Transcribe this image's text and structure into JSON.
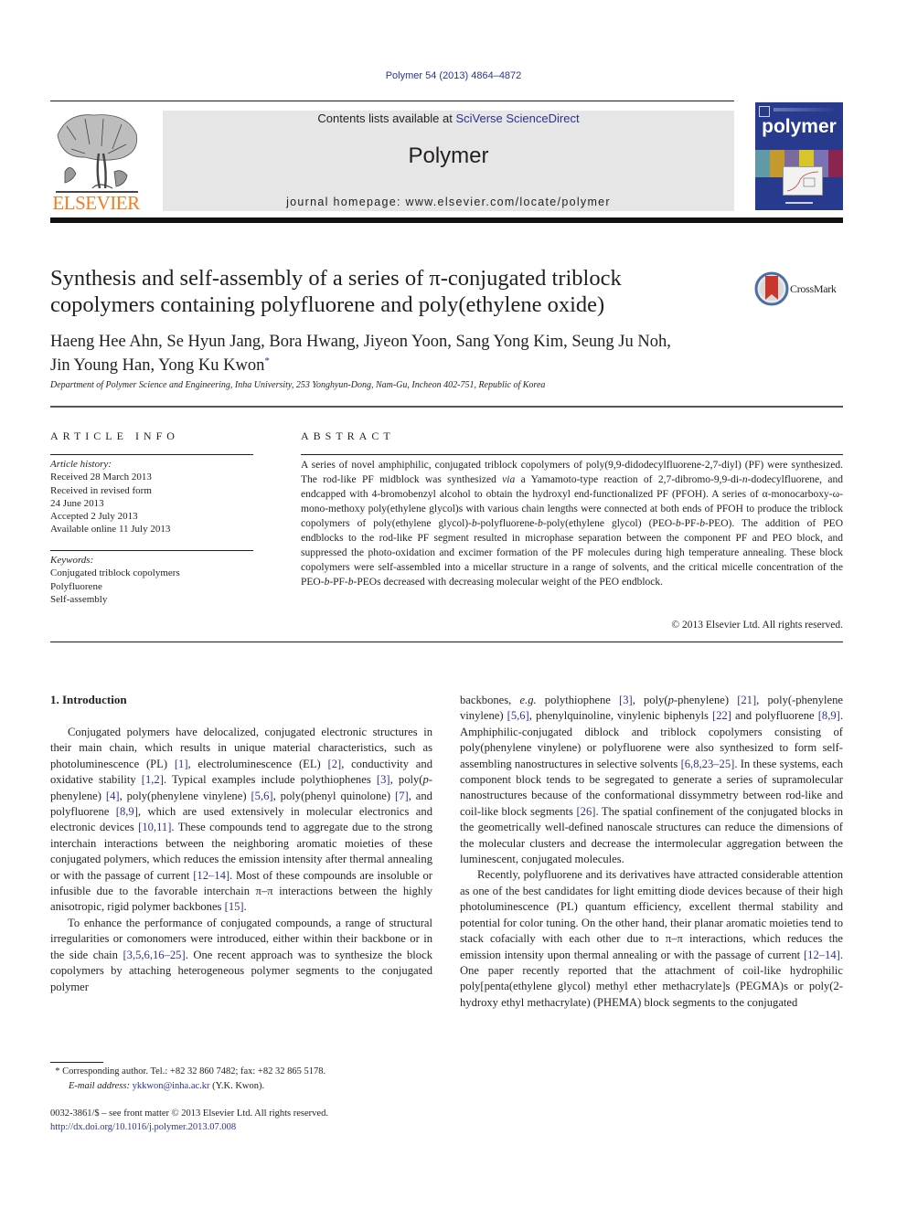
{
  "header": {
    "journal_ref": "Polymer 54 (2013) 4864–4872",
    "contents_prefix": "Contents lists available at ",
    "contents_link": "SciVerse ScienceDirect",
    "journal_name": "Polymer",
    "homepage": "journal homepage: www.elsevier.com/locate/polymer",
    "publisher_logo_text": "ELSEVIER",
    "cover_title": "polymer",
    "colors": {
      "publisher_orange": "#f47b20",
      "link_blue": "#2c3390",
      "cover_blue": "#283a8e",
      "masthead_gray": "#e6e6e6"
    }
  },
  "article": {
    "title_line1": "Synthesis and self-assembly of a series of π-conjugated triblock",
    "title_line2": "copolymers containing polyfluorene and poly(ethylene oxide)",
    "crossmark_label": "CrossMark",
    "authors_line1": "Haeng Hee Ahn, Se Hyun Jang, Bora Hwang, Jiyeon Yoon, Sang Yong Kim, Seung Ju Noh,",
    "authors_line2": "Jin Young Han, Yong Ku Kwon",
    "corresponding_mark": "*",
    "affiliation": "Department of Polymer Science and Engineering, Inha University, 253 Yonghyun-Dong, Nam-Gu, Incheon 402-751, Republic of Korea"
  },
  "article_info": {
    "heading": "ARTICLE INFO",
    "history_label": "Article history:",
    "history": [
      "Received 28 March 2013",
      "Received in revised form",
      "24 June 2013",
      "Accepted 2 July 2013",
      "Available online 11 July 2013"
    ],
    "keywords_label": "Keywords:",
    "keywords": [
      "Conjugated triblock copolymers",
      "Polyfluorene",
      "Self-assembly"
    ]
  },
  "abstract": {
    "heading": "ABSTRACT",
    "segments": [
      "A series of novel amphiphilic, conjugated triblock copolymers of poly(9,9-didodecylfluorene-2,7-diyl) (PF) were synthesized. The rod-like PF midblock was synthesized ",
      "via",
      " a Yamamoto-type reaction of 2,7-dibromo-9,9-di-",
      "n",
      "-dodecylfluorene, and endcapped with 4-bromobenzyl alcohol to obtain the hydroxyl end-functionalized PF (PFOH). A series of α-monocarboxy-ω-mono-methoxy poly(ethylene glycol)s with various chain lengths were connected at both ends of PFOH to produce the triblock copolymers of poly(ethylene glycol)-",
      "b",
      "-polyfluorene-",
      "b",
      "-poly(ethylene glycol) (PEO-",
      "b",
      "-PF-",
      "b",
      "-PEO). The addition of PEO endblocks to the rod-like PF segment resulted in microphase separation between the component PF and PEO block, and suppressed the photo-oxidation and excimer formation of the PF molecules during high temperature annealing. These block copolymers were self-assembled into a micellar structure in a range of solvents, and the critical micelle concentration of the PEO-",
      "b",
      "-PF-",
      "b",
      "-PEOs decreased with decreasing molecular weight of the PEO endblock."
    ],
    "copyright": "© 2013 Elsevier Ltd. All rights reserved."
  },
  "body": {
    "section_heading": "1.  Introduction",
    "left_p1": [
      {
        "t": "Conjugated polymers have delocalized, conjugated electronic structures in their main chain, which results in unique material characteristics, such as photoluminescence (PL) "
      },
      {
        "c": "[1]"
      },
      {
        "t": ", electrolumi­nescence (EL) "
      },
      {
        "c": "[2]"
      },
      {
        "t": ", conductivity and oxidative stability "
      },
      {
        "c": "[1,2]"
      },
      {
        "t": ". Typical examples include polythiophenes "
      },
      {
        "c": "[3]"
      },
      {
        "t": ", poly("
      },
      {
        "i": "p"
      },
      {
        "t": "-phenylene) "
      },
      {
        "c": "[4]"
      },
      {
        "t": ", poly(phenylene vinylene) "
      },
      {
        "c": "[5,6]"
      },
      {
        "t": ", poly(phenyl quinolone) "
      },
      {
        "c": "[7]"
      },
      {
        "t": ", and polyfluorene "
      },
      {
        "c": "[8,9]"
      },
      {
        "t": ", which are used extensively in molecular electronics and electronic devices "
      },
      {
        "c": "[10,11]"
      },
      {
        "t": ". These compounds tend to aggregate due to the strong interchain interactions between the neighboring aromatic moieties of these conjugated polymers, which reduces the emission intensity after thermal annealing or with the passage of current "
      },
      {
        "c": "[12–14]"
      },
      {
        "t": ". Most of these compounds are insoluble or infusible due to the favorable interchain π–π interactions between the highly anisotropic, rigid polymer backbones "
      },
      {
        "c": "[15]"
      },
      {
        "t": "."
      }
    ],
    "left_p2": [
      {
        "t": "To enhance the performance of conjugated compounds, a range of structural irregularities or comonomers were introduced, either within their backbone or in the side chain "
      },
      {
        "c": "[3,5,6,16–25]"
      },
      {
        "t": ". One recent approach was to synthesize the block copolymers by attaching heterogeneous polymer segments to the conjugated polymer"
      }
    ],
    "right_p1": [
      {
        "t": "backbones, "
      },
      {
        "i": "e.g."
      },
      {
        "t": " polythiophene "
      },
      {
        "c": "[3]"
      },
      {
        "t": ", poly("
      },
      {
        "i": "p"
      },
      {
        "t": "-phenylene) "
      },
      {
        "c": "[21]"
      },
      {
        "t": ", poly(-phenylene vinylene) "
      },
      {
        "c": "[5,6]"
      },
      {
        "t": ", phenylquinoline, vinylenic biphenyls "
      },
      {
        "c": "[22]"
      },
      {
        "t": " and polyfluorene "
      },
      {
        "c": "[8,9]"
      },
      {
        "t": ". Amphiphilic-conjugated diblock and triblock copolymers consisting of poly(phenylene vinylene) or polyfluorene were also synthesized to form self-assembling nano­structures in selective solvents "
      },
      {
        "c": "[6,8,23–25]"
      },
      {
        "t": ". In these systems, each component block tends to be segregated to generate a series of supramolecular nanostructures because of the conformational dissymmetry between rod-like and coil-like block segments "
      },
      {
        "c": "[26]"
      },
      {
        "t": ". The spatial confinement of the conjugated blocks in the geomet­rically well-defined nanoscale structures can reduce the di­mensions of the molecular clusters and decrease the intermolecular aggregation between the luminescent, conjugated molecules."
      }
    ],
    "right_p2": [
      {
        "t": "Recently, polyfluorene and its derivatives have attracted considerable attention as one of the best candidates for light emitting diode devices because of their high photoluminescence (PL) quantum efficiency, excellent thermal stability and potential for color tuning. On the other hand, their planar aromatic moieties tend to stack cofacially with each other due to π–π interactions, which reduces the emission intensity upon thermal annealing or with the passage of current "
      },
      {
        "c": "[12–14]"
      },
      {
        "t": ". One paper recently reported that the attachment of coil-like hydrophilic poly[penta(ethylene glycol) methyl ether methacrylate]s (PEGMA)s or poly(2-hydroxy ethyl methacrylate) (PHEMA) block segments to the conjugated"
      }
    ]
  },
  "footnote": {
    "mark": "*",
    "corresponding": " Corresponding author. Tel.: +82 32 860 7482; fax: +82 32 865 5178.",
    "email_label": "E-mail address: ",
    "email": "ykkwon@inha.ac.kr",
    "email_suffix": " (Y.K. Kwon)."
  },
  "front_matter": {
    "issn_line": "0032-3861/$ – see front matter © 2013 Elsevier Ltd. All rights reserved.",
    "doi": "http://dx.doi.org/10.1016/j.polymer.2013.07.008"
  }
}
